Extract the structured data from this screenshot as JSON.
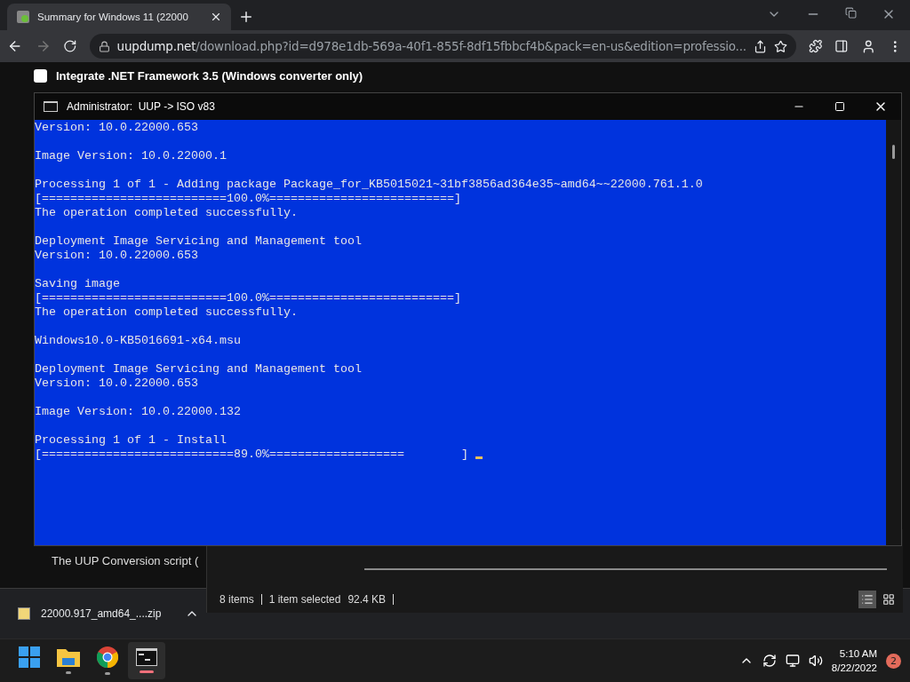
{
  "browser": {
    "tab": {
      "title": "Summary for Windows 11 (22000",
      "selected": true
    },
    "address": {
      "host": "uupdump.net",
      "path": "/download.php?id=d978e1db-569a-40f1-855f-8df15fbbcf4b&pack=en-us&edition=professio..."
    }
  },
  "page": {
    "options": [
      {
        "label": "Integrate .NET Framework 3.5 (Windows converter only)",
        "checked": false
      }
    ],
    "snippet": "The UUP Conversion script ("
  },
  "console": {
    "title": "Administrator:  UUP -> ISO v83",
    "blocks": [
      [
        "Version: 10.0.22000.653"
      ],
      [
        "Image Version: 10.0.22000.1"
      ],
      [
        "Processing 1 of 1 - Adding package Package_for_KB5015021~31bf3856ad364e35~amd64~~22000.761.1.0",
        "[==========================100.0%==========================]",
        "The operation completed successfully."
      ],
      [
        "Deployment Image Servicing and Management tool",
        "Version: 10.0.22000.653"
      ],
      [
        "Saving image",
        "[==========================100.0%==========================]",
        "The operation completed successfully."
      ],
      [
        "Windows10.0-KB5016691-x64.msu"
      ],
      [
        "Deployment Image Servicing and Management tool",
        "Version: 10.0.22000.653"
      ],
      [
        "Image Version: 10.0.22000.132"
      ],
      [
        "Processing 1 of 1 - Install",
        "[===========================89.0%===================        ]"
      ]
    ]
  },
  "explorer_status": {
    "items": "8 items",
    "selection": "1 item selected",
    "size": "92.4 KB"
  },
  "download": {
    "file": "22000.917_amd64_....zip"
  },
  "taskbar": {
    "apps": [
      {
        "kind": "start",
        "running": false,
        "active": false
      },
      {
        "kind": "folder",
        "running": true,
        "active": false
      },
      {
        "kind": "chrome",
        "running": true,
        "active": false
      },
      {
        "kind": "console",
        "running": true,
        "active": true
      }
    ],
    "time": "5:10 AM",
    "date": "8/22/2022",
    "notifications": "2"
  }
}
